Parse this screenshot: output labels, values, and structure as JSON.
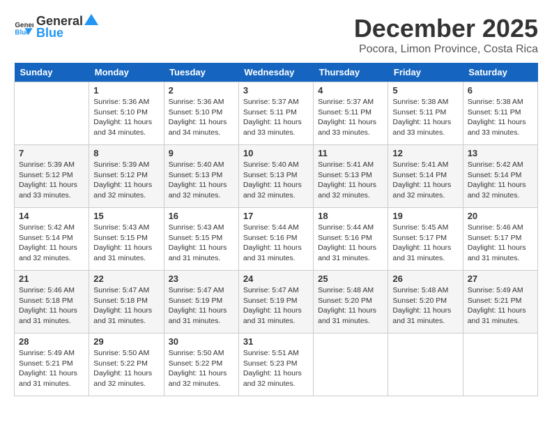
{
  "header": {
    "logo_line1": "General",
    "logo_line2": "Blue",
    "month": "December 2025",
    "location": "Pocora, Limon Province, Costa Rica"
  },
  "weekdays": [
    "Sunday",
    "Monday",
    "Tuesday",
    "Wednesday",
    "Thursday",
    "Friday",
    "Saturday"
  ],
  "weeks": [
    [
      {
        "day": "",
        "info": ""
      },
      {
        "day": "1",
        "info": "Sunrise: 5:36 AM\nSunset: 5:10 PM\nDaylight: 11 hours\nand 34 minutes."
      },
      {
        "day": "2",
        "info": "Sunrise: 5:36 AM\nSunset: 5:10 PM\nDaylight: 11 hours\nand 34 minutes."
      },
      {
        "day": "3",
        "info": "Sunrise: 5:37 AM\nSunset: 5:11 PM\nDaylight: 11 hours\nand 33 minutes."
      },
      {
        "day": "4",
        "info": "Sunrise: 5:37 AM\nSunset: 5:11 PM\nDaylight: 11 hours\nand 33 minutes."
      },
      {
        "day": "5",
        "info": "Sunrise: 5:38 AM\nSunset: 5:11 PM\nDaylight: 11 hours\nand 33 minutes."
      },
      {
        "day": "6",
        "info": "Sunrise: 5:38 AM\nSunset: 5:11 PM\nDaylight: 11 hours\nand 33 minutes."
      }
    ],
    [
      {
        "day": "7",
        "info": "Sunrise: 5:39 AM\nSunset: 5:12 PM\nDaylight: 11 hours\nand 33 minutes."
      },
      {
        "day": "8",
        "info": "Sunrise: 5:39 AM\nSunset: 5:12 PM\nDaylight: 11 hours\nand 32 minutes."
      },
      {
        "day": "9",
        "info": "Sunrise: 5:40 AM\nSunset: 5:13 PM\nDaylight: 11 hours\nand 32 minutes."
      },
      {
        "day": "10",
        "info": "Sunrise: 5:40 AM\nSunset: 5:13 PM\nDaylight: 11 hours\nand 32 minutes."
      },
      {
        "day": "11",
        "info": "Sunrise: 5:41 AM\nSunset: 5:13 PM\nDaylight: 11 hours\nand 32 minutes."
      },
      {
        "day": "12",
        "info": "Sunrise: 5:41 AM\nSunset: 5:14 PM\nDaylight: 11 hours\nand 32 minutes."
      },
      {
        "day": "13",
        "info": "Sunrise: 5:42 AM\nSunset: 5:14 PM\nDaylight: 11 hours\nand 32 minutes."
      }
    ],
    [
      {
        "day": "14",
        "info": "Sunrise: 5:42 AM\nSunset: 5:14 PM\nDaylight: 11 hours\nand 32 minutes."
      },
      {
        "day": "15",
        "info": "Sunrise: 5:43 AM\nSunset: 5:15 PM\nDaylight: 11 hours\nand 31 minutes."
      },
      {
        "day": "16",
        "info": "Sunrise: 5:43 AM\nSunset: 5:15 PM\nDaylight: 11 hours\nand 31 minutes."
      },
      {
        "day": "17",
        "info": "Sunrise: 5:44 AM\nSunset: 5:16 PM\nDaylight: 11 hours\nand 31 minutes."
      },
      {
        "day": "18",
        "info": "Sunrise: 5:44 AM\nSunset: 5:16 PM\nDaylight: 11 hours\nand 31 minutes."
      },
      {
        "day": "19",
        "info": "Sunrise: 5:45 AM\nSunset: 5:17 PM\nDaylight: 11 hours\nand 31 minutes."
      },
      {
        "day": "20",
        "info": "Sunrise: 5:46 AM\nSunset: 5:17 PM\nDaylight: 11 hours\nand 31 minutes."
      }
    ],
    [
      {
        "day": "21",
        "info": "Sunrise: 5:46 AM\nSunset: 5:18 PM\nDaylight: 11 hours\nand 31 minutes."
      },
      {
        "day": "22",
        "info": "Sunrise: 5:47 AM\nSunset: 5:18 PM\nDaylight: 11 hours\nand 31 minutes."
      },
      {
        "day": "23",
        "info": "Sunrise: 5:47 AM\nSunset: 5:19 PM\nDaylight: 11 hours\nand 31 minutes."
      },
      {
        "day": "24",
        "info": "Sunrise: 5:47 AM\nSunset: 5:19 PM\nDaylight: 11 hours\nand 31 minutes."
      },
      {
        "day": "25",
        "info": "Sunrise: 5:48 AM\nSunset: 5:20 PM\nDaylight: 11 hours\nand 31 minutes."
      },
      {
        "day": "26",
        "info": "Sunrise: 5:48 AM\nSunset: 5:20 PM\nDaylight: 11 hours\nand 31 minutes."
      },
      {
        "day": "27",
        "info": "Sunrise: 5:49 AM\nSunset: 5:21 PM\nDaylight: 11 hours\nand 31 minutes."
      }
    ],
    [
      {
        "day": "28",
        "info": "Sunrise: 5:49 AM\nSunset: 5:21 PM\nDaylight: 11 hours\nand 31 minutes."
      },
      {
        "day": "29",
        "info": "Sunrise: 5:50 AM\nSunset: 5:22 PM\nDaylight: 11 hours\nand 32 minutes."
      },
      {
        "day": "30",
        "info": "Sunrise: 5:50 AM\nSunset: 5:22 PM\nDaylight: 11 hours\nand 32 minutes."
      },
      {
        "day": "31",
        "info": "Sunrise: 5:51 AM\nSunset: 5:23 PM\nDaylight: 11 hours\nand 32 minutes."
      },
      {
        "day": "",
        "info": ""
      },
      {
        "day": "",
        "info": ""
      },
      {
        "day": "",
        "info": ""
      }
    ]
  ]
}
